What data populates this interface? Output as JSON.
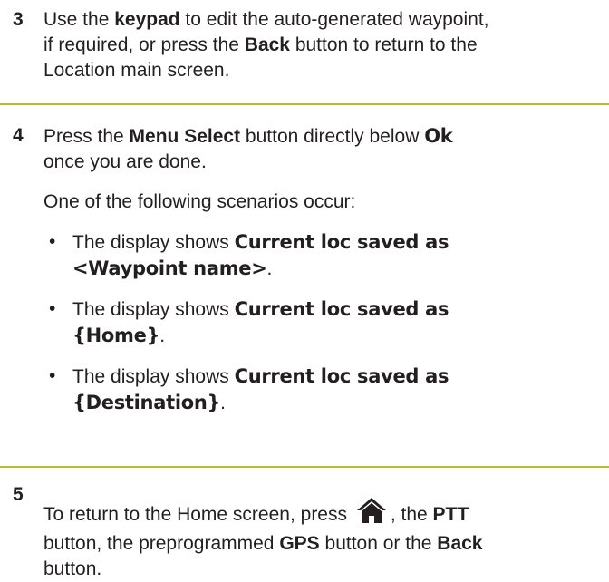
{
  "step3": {
    "number": "3",
    "t1": "Use the ",
    "b1": "keypad",
    "t2": " to edit the auto-generated waypoint,",
    "t3": "if required, or press the ",
    "b2": "Back",
    "t4": " button to return to the",
    "t5": "Location main screen."
  },
  "step4": {
    "number": "4",
    "t1": "Press the ",
    "b1": "Menu Select",
    "t2": " button directly below ",
    "ui_ok": "Ok",
    "t3": "once you are done.",
    "intro": "One of the following scenarios occur:",
    "bullet": "•",
    "scenarios": [
      {
        "prefix": "The display shows ",
        "ui1": "Current loc saved as",
        "ui2": "<Waypoint name>",
        "suffix": "."
      },
      {
        "prefix": "The display shows ",
        "ui1": "Current loc saved as",
        "ui2": "{Home}",
        "suffix": "."
      },
      {
        "prefix": "The display shows ",
        "ui1": "Current loc saved as",
        "ui2": "{Destination}",
        "suffix": "."
      }
    ]
  },
  "step5": {
    "number": "5",
    "t1": "To return to the Home screen, press ",
    "home_icon": "home-icon",
    "t2": ", the ",
    "b1": "PTT",
    "t3": "button, the preprogrammed ",
    "b2": "GPS",
    "t4": " button or the ",
    "b3": "Back",
    "t5": "button."
  },
  "colors": {
    "rule": "#b5bd2b",
    "text": "#231f20"
  }
}
